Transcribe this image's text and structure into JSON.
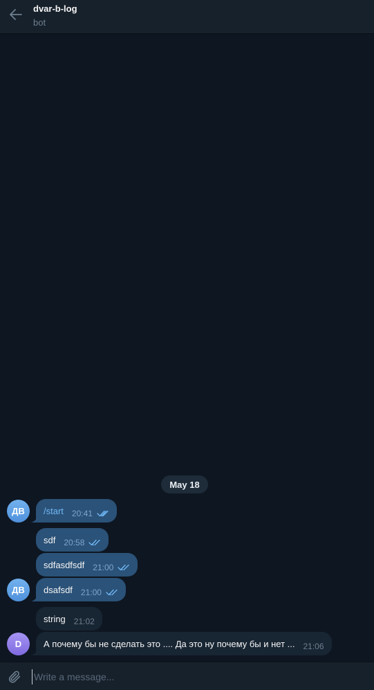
{
  "header": {
    "title": "dvar-b-log",
    "subtitle": "bot"
  },
  "date_badge": "May 18",
  "avatars": {
    "user_initials": "ДВ",
    "bot_initial": "D"
  },
  "messages": [
    {
      "text": "/start",
      "time": "20:41",
      "read": true,
      "link": true
    },
    {
      "text": "sdf",
      "time": "20:58",
      "read": true
    },
    {
      "text": "sdfasdfsdf",
      "time": "21:00",
      "read": true
    },
    {
      "text": "dsafsdf",
      "time": "21:00",
      "read": true
    },
    {
      "text": "string",
      "time": "21:02"
    },
    {
      "text": "А почему бы не сделать это .... Да это ну почему бы и нет ...",
      "time": "21:06"
    }
  ],
  "composer": {
    "placeholder": "Write a message..."
  },
  "colors": {
    "background": "#0e1621",
    "header": "#17212b",
    "outgoing_bubble": "#2b5278",
    "incoming_bubble": "#182533",
    "accent": "#71b9f8"
  }
}
